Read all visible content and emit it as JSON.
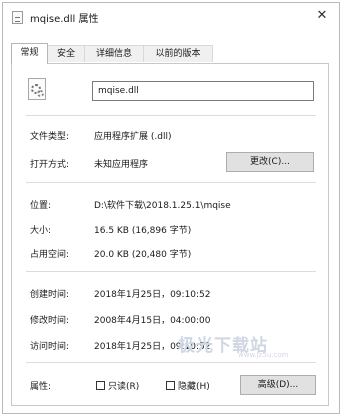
{
  "window": {
    "title": "mqise.dll 属性",
    "close_glyph": "✕"
  },
  "tabs": [
    {
      "label": "常规",
      "active": true
    },
    {
      "label": "安全",
      "active": false
    },
    {
      "label": "详细信息",
      "active": false
    },
    {
      "label": "以前的版本",
      "active": false
    }
  ],
  "general": {
    "file_name": "mqise.dll",
    "file_type": {
      "label": "文件类型:",
      "value": "应用程序扩展 (.dll)"
    },
    "opens_with": {
      "label": "打开方式:",
      "value": "未知应用程序",
      "change_button": "更改(C)..."
    },
    "location": {
      "label": "位置:",
      "value": "D:\\软件下载\\2018.1.25.1\\mqise"
    },
    "size": {
      "label": "大小:",
      "value": "16.5 KB (16,896 字节)"
    },
    "size_on_disk": {
      "label": "占用空间:",
      "value": "20.0 KB (20,480 字节)"
    },
    "created": {
      "label": "创建时间:",
      "value": "2018年1月25日，09:10:52"
    },
    "modified": {
      "label": "修改时间:",
      "value": "2008年4月15日，04:00:00"
    },
    "accessed": {
      "label": "访问时间:",
      "value": "2018年1月25日，09:10:52"
    },
    "attributes": {
      "label": "属性:",
      "readonly": {
        "label": "只读(R)",
        "checked": false
      },
      "hidden": {
        "label": "隐藏(H)",
        "checked": false
      },
      "advanced_button": "高级(D)..."
    }
  },
  "watermark": {
    "text": "极光下载站",
    "url": "www.jz5u.com"
  },
  "colors": {
    "tab_active_bg": "#ffffff",
    "button_bg": "#e1e1e1",
    "border": "#adadad"
  }
}
